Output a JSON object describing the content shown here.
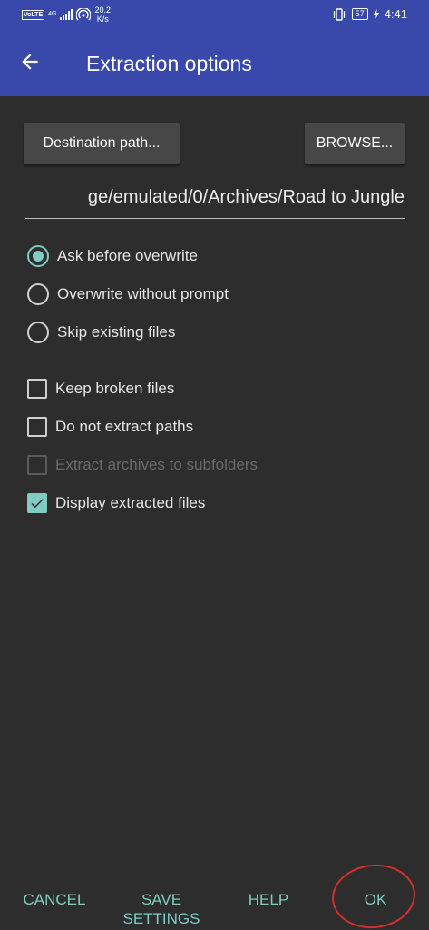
{
  "status_bar": {
    "volte": "VoLTE",
    "network": "4G",
    "speed_value": "20.2",
    "speed_unit": "K/s",
    "battery": "57",
    "time": "4:41"
  },
  "app_bar": {
    "title": "Extraction options",
    "back_icon": "arrow-back-icon"
  },
  "destination": {
    "path_button_label": "Destination path...",
    "browse_button_label": "BROWSE...",
    "path_value": "ge/emulated/0/Archives/Road to Jungle"
  },
  "overwrite_mode": {
    "options": [
      {
        "label": "Ask before overwrite",
        "selected": true
      },
      {
        "label": "Overwrite without prompt",
        "selected": false
      },
      {
        "label": "Skip existing files",
        "selected": false
      }
    ]
  },
  "checkboxes": [
    {
      "label": "Keep broken files",
      "checked": false,
      "enabled": true
    },
    {
      "label": "Do not extract paths",
      "checked": false,
      "enabled": true
    },
    {
      "label": "Extract archives to subfolders",
      "checked": false,
      "enabled": false
    },
    {
      "label": "Display extracted files",
      "checked": true,
      "enabled": true
    }
  ],
  "bottom_bar": {
    "cancel": "CANCEL",
    "save_line1": "SAVE",
    "save_line2": "SETTINGS",
    "help": "HELP",
    "ok": "OK"
  },
  "colors": {
    "app_bar": "#3949ab",
    "background": "#2d2d2d",
    "accent": "#80cbc4",
    "annotation_circle": "#d32f2f"
  }
}
